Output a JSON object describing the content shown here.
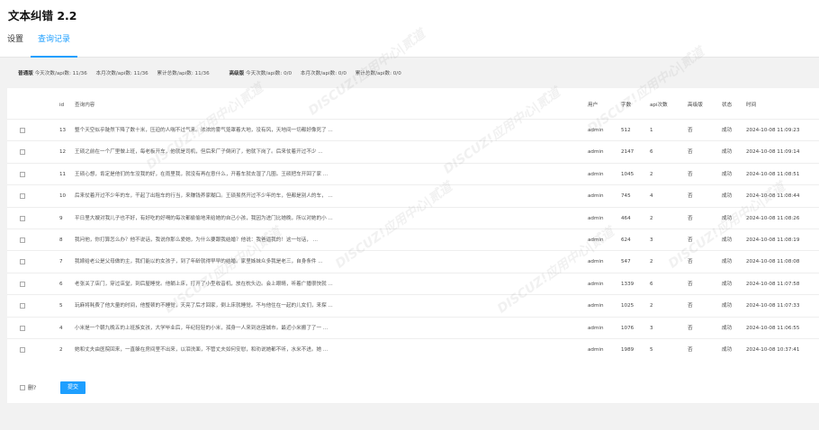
{
  "app": {
    "title": "文本纠错 2.2"
  },
  "tabs": [
    {
      "label": "设置",
      "active": false
    },
    {
      "label": "查询记录",
      "active": true
    }
  ],
  "stats": {
    "normal_label": "普通版",
    "normal_today": "今天次数/api数: 11/36",
    "normal_month": "本月次数/api数: 11/36",
    "normal_total": "累计总数/api数: 11/36",
    "adv_label": "高级版",
    "adv_today": "今天次数/api数: 0/0",
    "adv_month": "本月次数/api数: 0/0",
    "adv_total": "累计总数/api数: 0/0"
  },
  "table": {
    "headers": {
      "id": "id",
      "content": "查询内容",
      "user": "用户",
      "chars": "字数",
      "api": "api次数",
      "advanced": "高级版",
      "status": "状态",
      "time": "时间"
    },
    "rows": [
      {
        "id": "13",
        "content": "整个天空似乎陡然下降了数十米，压迫的人喘不过气来。浓浓的雾气笼罩着大地，没有风，天地间一切都好像死了 ...",
        "user": "admin",
        "chars": "512",
        "api": "1",
        "advanced": "否",
        "status": "成功",
        "time": "2024-10-08 11:09:23"
      },
      {
        "id": "12",
        "content": "王硕之前在一个厂里做上班，每老板开车，他就是司机，但后来厂子倒闭了，他就下岗了。后来仗着开过不少 ...",
        "user": "admin",
        "chars": "2147",
        "api": "6",
        "advanced": "否",
        "status": "成功",
        "time": "2024-10-08 11:09:14"
      },
      {
        "id": "11",
        "content": "王硕心想，肯定是他们的车没我的好，在雨里我，就没有再在意什么，开着车就去湿了几圈。王硕把车开回了家 ...",
        "user": "admin",
        "chars": "1045",
        "api": "2",
        "advanced": "否",
        "status": "成功",
        "time": "2024-10-08 11:08:51"
      },
      {
        "id": "10",
        "content": "后来仗着开过不少年的车，干起了出租车的行当，来赚钱养家糊口。王硕虽然开过不少年的车，但都是别人的车， ...",
        "user": "admin",
        "chars": "745",
        "api": "4",
        "advanced": "否",
        "status": "成功",
        "time": "2024-10-08 11:08:44"
      },
      {
        "id": "9",
        "content": "平日里大嫂对我儿子也不好，有好吃的好喝的每次都偷偷地来给她的自己小孩，我因为进门比她晚，所以对她的小 ...",
        "user": "admin",
        "chars": "464",
        "api": "2",
        "advanced": "否",
        "status": "成功",
        "time": "2024-10-08 11:08:26"
      },
      {
        "id": "8",
        "content": "我问他，你打算怎么办？他不说话，我说你那么爱她，为什么要跟我结婚？他说：我爸逼我的！这一句话， ...",
        "user": "admin",
        "chars": "624",
        "api": "3",
        "advanced": "否",
        "status": "成功",
        "time": "2024-10-08 11:08:19"
      },
      {
        "id": "7",
        "content": "我嫁给老公是父母做的主，我们能以的女孩子，到了年龄就得早早的结婚。家里姊妹众多我是老三，自身条件 ...",
        "user": "admin",
        "chars": "547",
        "api": "2",
        "advanced": "否",
        "status": "成功",
        "time": "2024-10-08 11:08:08"
      },
      {
        "id": "6",
        "content": "老张关了店门，穿过店堂，到后屋睡觉。他躺上床，打开了小型收音机，放在枕头边。会上眼睛，听着广播很快就 ...",
        "user": "admin",
        "chars": "1339",
        "api": "6",
        "advanced": "否",
        "status": "成功",
        "time": "2024-10-08 11:07:58"
      },
      {
        "id": "5",
        "content": "玩麻将耗费了他大量的时间，他整顿的不睡觉，天亮了后才回家，倒上床就睡觉。不与他住在一起的儿女们，来探 ...",
        "user": "admin",
        "chars": "1025",
        "api": "2",
        "advanced": "否",
        "status": "成功",
        "time": "2024-10-08 11:07:33"
      },
      {
        "id": "4",
        "content": "小米是一个朝九晚五的上班族女孩，大学毕业后，年纪轻轻的小米，孤身一人来到这座城市。最近小米搬了了一 ...",
        "user": "admin",
        "chars": "1076",
        "api": "3",
        "advanced": "否",
        "status": "成功",
        "time": "2024-10-08 11:06:55"
      },
      {
        "id": "2",
        "content": "她和丈夫由医院回来，一直躲在房间里不出来，以泪洗面，不管丈夫如何安慰，和劝说她都不听，水米不进。她 ...",
        "user": "admin",
        "chars": "1989",
        "api": "5",
        "advanced": "否",
        "status": "成功",
        "time": "2024-10-08 10:37:41"
      }
    ]
  },
  "footer": {
    "delete_label": "删?",
    "submit_label": "提交"
  },
  "watermark": {
    "text": "DISCUZ!应用中心|贰道",
    "subtext": "addon.dismall.com"
  },
  "colors": {
    "accent": "#1e9fff"
  }
}
